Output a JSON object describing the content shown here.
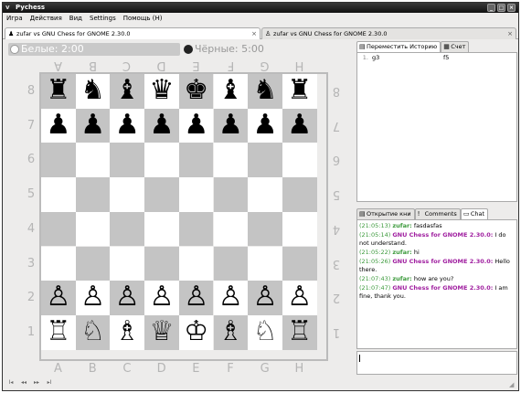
{
  "window": {
    "title": "Pychess",
    "menu_glyph": "v"
  },
  "menubar": {
    "items": [
      "Игра",
      "Действия",
      "Вид",
      "Settings",
      "Помощь (H)"
    ]
  },
  "tabs": [
    {
      "label": "zufar vs GNU Chess for GNOME 2.30.0",
      "active": true,
      "close": "×"
    },
    {
      "label": "zufar vs GNU Chess for GNOME 2.30.0",
      "active": false,
      "close": "×"
    }
  ],
  "clocks": {
    "white": "Белые: 2:00",
    "black": "Чёрные: 5:00"
  },
  "board": {
    "files_top": [
      "A",
      "B",
      "C",
      "D",
      "E",
      "F",
      "G",
      "H"
    ],
    "files_bottom": [
      "A",
      "B",
      "C",
      "D",
      "E",
      "F",
      "G",
      "H"
    ],
    "ranks_left": [
      "8",
      "7",
      "6",
      "5",
      "4",
      "3",
      "2",
      "1"
    ],
    "ranks_right": [
      "8",
      "7",
      "6",
      "5",
      "4",
      "3",
      "2",
      "1"
    ],
    "position": [
      [
        "♜",
        "♞",
        "♝",
        "♛",
        "♚",
        "♝",
        "♞",
        "♜"
      ],
      [
        "♟",
        "♟",
        "♟",
        "♟",
        "♟",
        "♟",
        "♟",
        "♟"
      ],
      [
        "",
        "",
        "",
        "",
        "",
        "",
        "",
        ""
      ],
      [
        "",
        "",
        "",
        "",
        "",
        "",
        "",
        ""
      ],
      [
        "",
        "",
        "",
        "",
        "",
        "",
        "",
        ""
      ],
      [
        "",
        "",
        "",
        "",
        "",
        "",
        "",
        ""
      ],
      [
        "♙",
        "♙",
        "♙",
        "♙",
        "♙",
        "♙",
        "♙",
        "♙"
      ],
      [
        "♖",
        "♘",
        "♗",
        "♕",
        "♔",
        "♗",
        "♘",
        "♖"
      ]
    ]
  },
  "right_panel": {
    "top_tabs": [
      "Переместить Историю",
      "Счет"
    ],
    "history": [
      {
        "num": "1.",
        "white": "g3",
        "black": "f5"
      }
    ],
    "bottom_tabs": [
      "Открытие кни",
      "Comments",
      "Chat"
    ],
    "chat": [
      {
        "time": "(21:05:13)",
        "user": "zufar:",
        "kind": "u1",
        "text": " fasdasfas"
      },
      {
        "time": "(21:05:14)",
        "user": "GNU Chess for GNOME 2.30.0:",
        "kind": "u2",
        "text": " I do not understand."
      },
      {
        "time": "(21:05:22)",
        "user": "zufar:",
        "kind": "u1",
        "text": " hi"
      },
      {
        "time": "(21:05:26)",
        "user": "GNU Chess for GNOME 2.30.0:",
        "kind": "u2",
        "text": " Hello there."
      },
      {
        "time": "(21:07:43)",
        "user": "zufar:",
        "kind": "u1",
        "text": " how are you?"
      },
      {
        "time": "(21:07:47)",
        "user": "GNU Chess for GNOME 2.30.0:",
        "kind": "u2",
        "text": " I am fine, thank you."
      }
    ]
  },
  "statusbar": {
    "nav": [
      "I◂",
      "◂◂",
      "▸▸",
      "▸I"
    ]
  }
}
